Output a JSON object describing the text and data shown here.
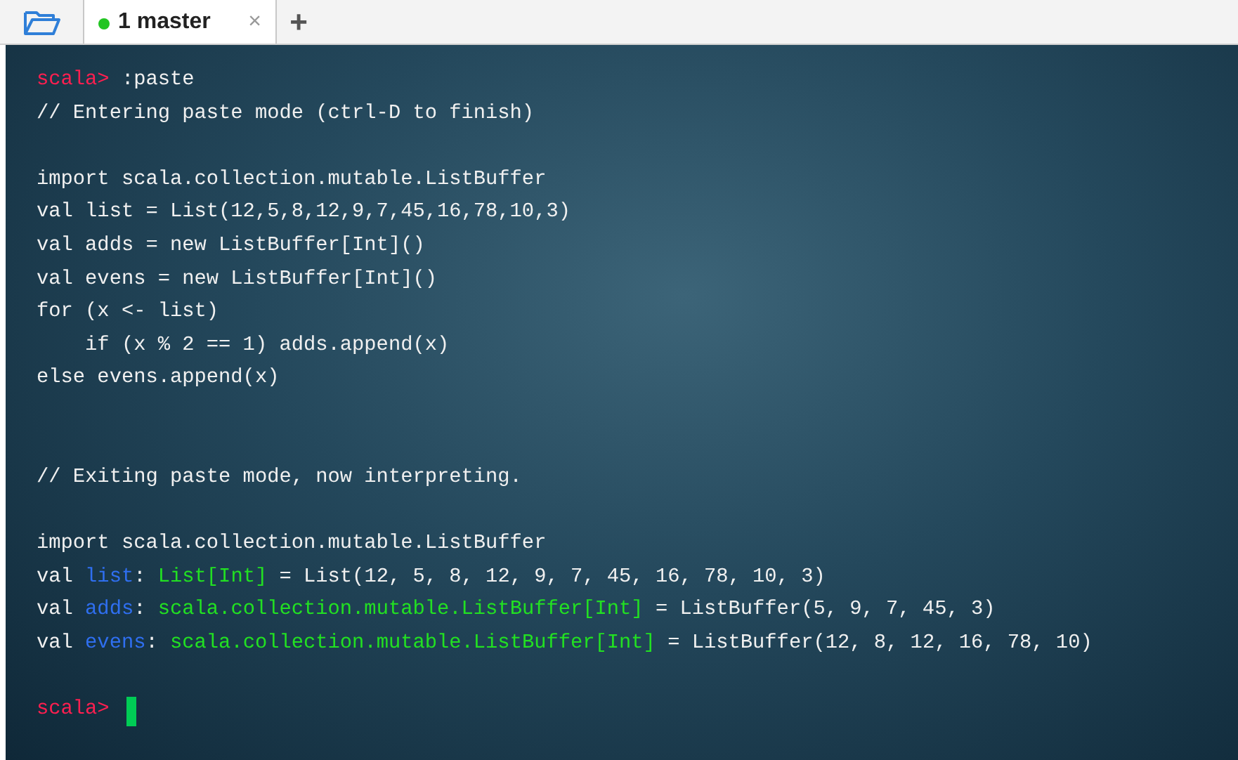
{
  "tabs": [
    {
      "label": "1 master",
      "selected": true,
      "color": "#22c522",
      "close": "×"
    }
  ],
  "new_tab": "+",
  "terminal": {
    "lines": [
      {
        "kind": "text",
        "segments": [
          {
            "kind": "prompt",
            "text": "scala>"
          },
          {
            "kind": "plain",
            "text": " :paste"
          }
        ]
      },
      {
        "kind": "text",
        "segments": [
          {
            "kind": "plain",
            "text": "// Entering paste mode (ctrl-D to finish)"
          }
        ]
      },
      {
        "kind": "blank"
      },
      {
        "kind": "text",
        "segments": [
          {
            "kind": "plain",
            "text": "import scala.collection.mutable.ListBuffer"
          }
        ]
      },
      {
        "kind": "text",
        "segments": [
          {
            "kind": "plain",
            "text": "val list = List(12,5,8,12,9,7,45,16,78,10,3)"
          }
        ]
      },
      {
        "kind": "text",
        "segments": [
          {
            "kind": "plain",
            "text": "val adds = new ListBuffer[Int]()"
          }
        ]
      },
      {
        "kind": "text",
        "segments": [
          {
            "kind": "plain",
            "text": "val evens = new ListBuffer[Int]()"
          }
        ]
      },
      {
        "kind": "text",
        "segments": [
          {
            "kind": "plain",
            "text": "for (x <- list)"
          }
        ]
      },
      {
        "kind": "text",
        "segments": [
          {
            "kind": "plain",
            "text": "    if (x % 2 == 1) adds.append(x)"
          }
        ]
      },
      {
        "kind": "text",
        "segments": [
          {
            "kind": "plain",
            "text": "else evens.append(x)"
          }
        ]
      },
      {
        "kind": "blank"
      },
      {
        "kind": "blank"
      },
      {
        "kind": "text",
        "segments": [
          {
            "kind": "plain",
            "text": "// Exiting paste mode, now interpreting."
          }
        ]
      },
      {
        "kind": "blank"
      },
      {
        "kind": "text",
        "segments": [
          {
            "kind": "plain",
            "text": "import scala.collection.mutable.ListBuffer"
          }
        ]
      },
      {
        "kind": "text",
        "segments": [
          {
            "kind": "plain",
            "text": "val "
          },
          {
            "kind": "ident",
            "text": "list"
          },
          {
            "kind": "plain",
            "text": ": "
          },
          {
            "kind": "type",
            "text": "List[Int]"
          },
          {
            "kind": "plain",
            "text": " = List(12, 5, 8, 12, 9, 7, 45, 16, 78, 10, 3)"
          }
        ]
      },
      {
        "kind": "text",
        "segments": [
          {
            "kind": "plain",
            "text": "val "
          },
          {
            "kind": "ident",
            "text": "adds"
          },
          {
            "kind": "plain",
            "text": ": "
          },
          {
            "kind": "type",
            "text": "scala.collection.mutable.ListBuffer[Int]"
          },
          {
            "kind": "plain",
            "text": " = ListBuffer(5, 9, 7, 45, 3)"
          }
        ]
      },
      {
        "kind": "text",
        "segments": [
          {
            "kind": "plain",
            "text": "val "
          },
          {
            "kind": "ident",
            "text": "evens"
          },
          {
            "kind": "plain",
            "text": ": "
          },
          {
            "kind": "type",
            "text": "scala.collection.mutable.ListBuffer[Int]"
          },
          {
            "kind": "plain",
            "text": " = ListBuffer(12, 8, 12, 16, 78, 10)"
          }
        ]
      },
      {
        "kind": "blank"
      },
      {
        "kind": "text",
        "cursor": true,
        "segments": [
          {
            "kind": "prompt",
            "text": "scala>"
          }
        ]
      }
    ]
  }
}
